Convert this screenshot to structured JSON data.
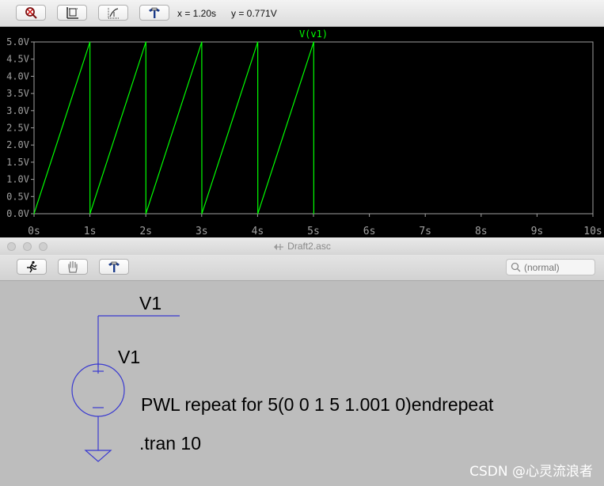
{
  "waveform": {
    "toolbar": {
      "buttons": [
        {
          "name": "zoom-cancel",
          "icon": "zoom-cancel-icon"
        },
        {
          "name": "autorange",
          "icon": "autorange-icon"
        },
        {
          "name": "cursor-measure",
          "icon": "cursor-measure-icon"
        },
        {
          "name": "probe",
          "icon": "probe-hammer-icon"
        }
      ],
      "x_readout": "x = 1.20s",
      "y_readout": "y = 0.771V"
    },
    "trace_color": "#00ff00",
    "grid_color": "#a0a0a0"
  },
  "chart_data": {
    "type": "line",
    "title": "V(v1)",
    "xlabel": "",
    "ylabel": "",
    "xlim": [
      0,
      10
    ],
    "ylim": [
      0,
      5
    ],
    "x_ticks": [
      "0s",
      "1s",
      "2s",
      "3s",
      "4s",
      "5s",
      "6s",
      "7s",
      "8s",
      "9s",
      "10s"
    ],
    "y_ticks": [
      "0.0V",
      "0.5V",
      "1.0V",
      "1.5V",
      "2.0V",
      "2.5V",
      "3.0V",
      "3.5V",
      "4.0V",
      "4.5V",
      "5.0V"
    ],
    "series": [
      {
        "name": "V(v1)",
        "x": [
          0,
          1,
          1.001,
          2.001,
          2.002,
          3.002,
          3.003,
          4.003,
          4.004,
          5.004,
          5.005
        ],
        "y": [
          0,
          5,
          0,
          5,
          0,
          5,
          0,
          5,
          0,
          5,
          0
        ]
      }
    ]
  },
  "schematic": {
    "title": "Draft2.asc",
    "search_placeholder": "(normal)",
    "net_label": "V1",
    "component_name": "V1",
    "source_value": "PWL repeat for 5(0 0 1 5 1.001 0)endrepeat",
    "directive": ".tran 10",
    "wire_color": "#3a3ad0",
    "toolbar": {
      "buttons": [
        {
          "name": "run",
          "icon": "running-man-icon"
        },
        {
          "name": "pan",
          "icon": "hand-icon"
        },
        {
          "name": "probe",
          "icon": "probe-hammer-icon"
        }
      ]
    }
  },
  "watermark": "CSDN @心灵流浪者"
}
